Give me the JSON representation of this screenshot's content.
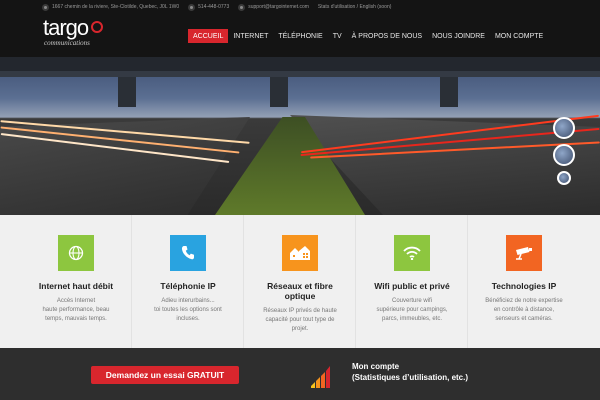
{
  "topbar": {
    "address": "1667 chemin de la riviere, Ste-Clotilde, Quebec, J0L 1W0",
    "phone": "514-448-0773",
    "email": "support@targointernet.com",
    "links": "Stats d'utilisation / English (soon)"
  },
  "logo": {
    "word": "targo",
    "sub": "communications"
  },
  "nav": {
    "items": [
      "ACCUEIL",
      "INTERNET",
      "TÉLÉPHONIE",
      "TV",
      "À PROPOS DE NOUS",
      "NOUS JOINDRE",
      "MON COMPTE"
    ],
    "active": "ACCUEIL"
  },
  "features": [
    {
      "title": "Internet haut débit",
      "desc": "Accès Internet\nhaute performance, beau\ntemps, mauvais temps.",
      "icon": "globe-icon",
      "color": "#8dc63f"
    },
    {
      "title": "Téléphonie IP",
      "desc": "Adieu interurbains...\ntoi toutes les options sont\nincluses.",
      "icon": "phone-icon",
      "color": "#29a3e0"
    },
    {
      "title": "Réseaux et fibre\noptique",
      "desc": "Réseaux IP privés de haute\ncapacité pour tout type de\nprojet.",
      "icon": "houses-icon",
      "color": "#f7941d"
    },
    {
      "title": "Wifi public et privé",
      "desc": "Couverture wifi\nsupérieure pour campings,\nparcs, immeubles, etc.",
      "icon": "wifi-icon",
      "color": "#8dc63f"
    },
    {
      "title": "Technologies IP",
      "desc": "Bénéficiez de notre expertise\nen contrôle à distance,\nsenseurs et caméras.",
      "icon": "camera-icon",
      "color": "#f26522"
    }
  ],
  "footer": {
    "cta": "Demandez un essai GRATUIT",
    "account_title": "Mon compte\n(Statistiques d’utilisation, etc.)"
  },
  "colors": {
    "accent": "#d8262d",
    "header_bg": "#141414",
    "footer_bg": "#2e2e2e"
  }
}
